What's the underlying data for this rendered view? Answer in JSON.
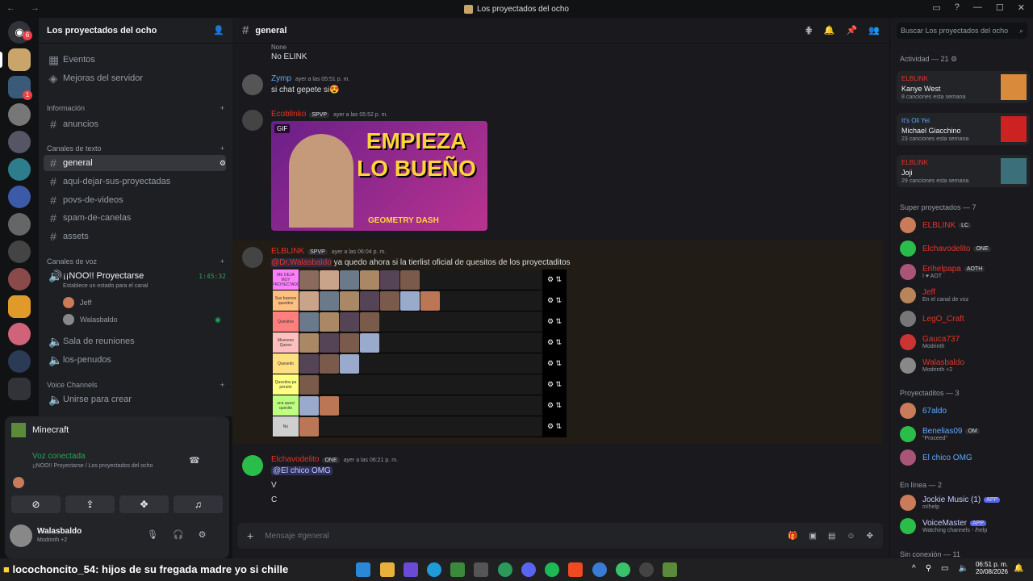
{
  "window": {
    "title": "Los proyectados del ocho"
  },
  "guild": {
    "name": "Los proyectados del ocho",
    "badge": "6"
  },
  "channels": {
    "top": [
      "Eventos",
      "Mejoras del servidor"
    ],
    "cat_info": "Información",
    "info": [
      "anuncios"
    ],
    "cat_text": "Canales de texto",
    "text": [
      "general",
      "aqui-dejar-sus-proyectadas",
      "povs-de-videos",
      "spam-de-canelas",
      "assets"
    ],
    "cat_voice": "Canales de voz",
    "voice_main": "¡¡NOO!! Proyectarse",
    "voice_status": "Establece un estado para el canal",
    "voice_timer": "1:45:32",
    "voice_users": [
      "Jeff",
      "Walasbaldo"
    ],
    "voice_other": [
      "Sala de reuniones",
      "los-penudos"
    ],
    "cat_voice2": "Voice Channels",
    "voice2": [
      "Unirse para crear"
    ]
  },
  "activity_card": {
    "game": "Minecraft",
    "status": "Voz conectada",
    "path": "¡¡NOO!! Proyectarse / Los proyectados del ocho"
  },
  "user": {
    "name": "Walasbaldo",
    "sub": "Modrinth +2"
  },
  "header": {
    "channel": "general",
    "search_placeholder": "Buscar Los proyectados del ocho"
  },
  "messages": [
    {
      "text_top": "None",
      "text": "No ELINK"
    },
    {
      "author": "Zymp",
      "time": "ayer a las 05:51 p. m.",
      "text": "si chat gepete si😍"
    },
    {
      "author": "Ecoblinko",
      "tag": "SPVP",
      "time": "ayer a las 05:52 p. m.",
      "gif_label": "GIF",
      "gif_text": "EMPIEZA LO BUEÑO",
      "gif_sub": "GEOMETRY DASH"
    },
    {
      "author": "ELBLINK",
      "tag": "SPVP",
      "time": "ayer a las 06:04 p. m.",
      "mention": "@Dr.Walasbaldo",
      "text": "ya quedo ahora si la tierlist oficial de quesitos de los proyectaditos"
    },
    {
      "author": "Elchavodelito",
      "tag": "ONE",
      "time": "ayer a las 06:21 p. m.",
      "mention": "@El chico OMG",
      "lines": [
        "V",
        "C"
      ]
    }
  ],
  "tierlist": {
    "labels": [
      "ME DEJA MUY PROYECTAD0",
      "Sus buenos quesitos",
      "Quesitos",
      "Mesoeso Queso",
      "Queseito",
      "Quesitos pa peruito",
      "una quesi quesito",
      "No"
    ],
    "colors": [
      "#ff7fff",
      "#ffbf7f",
      "#ff7f7f",
      "#ffbfbf",
      "#ffdf7f",
      "#ffff7f",
      "#bfff7f",
      "#cfcfcf"
    ],
    "counts": [
      6,
      7,
      4,
      4,
      3,
      1,
      2,
      1
    ]
  },
  "composer": {
    "placeholder": "Mensaje #general"
  },
  "members": {
    "activity_title": "Actividad — 21",
    "activity": [
      {
        "who": "ELBLINK",
        "track": "Kanye West",
        "sub": "8 canciones esta semana"
      },
      {
        "who": "It's Oli Yei",
        "track": "Michael Giacchino",
        "sub": "23 canciones esta semana"
      },
      {
        "who": "ELBLINK",
        "track": "Joji",
        "sub": "29 canciones esta semana"
      }
    ],
    "group1": "Super proyectados — 7",
    "g1": [
      {
        "n": "ELBLINK",
        "tag": "LC",
        "sub": ""
      },
      {
        "n": "Elchavodelito",
        "tag": "ONE",
        "sub": ""
      },
      {
        "n": "Erihelpapa",
        "tag": "AOTH",
        "sub": "I ♥ AOT"
      },
      {
        "n": "Jeff",
        "tag": "",
        "sub": "En el canal de voz"
      },
      {
        "n": "LegO_Craft",
        "tag": "",
        "sub": ""
      },
      {
        "n": "Gauca737",
        "tag": "",
        "sub": "Modrinth"
      },
      {
        "n": "Walasbaldo",
        "tag": "",
        "sub": "Modrinth +2"
      }
    ],
    "group2": "Proyectaditos — 3",
    "g2": [
      {
        "n": "67aldo",
        "tag": "",
        "sub": ""
      },
      {
        "n": "Benelias09",
        "tag": "OM",
        "sub": "\"Proceed\""
      },
      {
        "n": "El chico OMG",
        "tag": "",
        "sub": ""
      }
    ],
    "group3": "En línea — 2",
    "g3": [
      {
        "n": "Jockie Music (1)",
        "tag": "APP",
        "sub": "m!help"
      },
      {
        "n": "VoiceMaster",
        "tag": "APP",
        "sub": "Watching channels - /help"
      }
    ],
    "group4": "Sin conexión — 11"
  },
  "taskbar": {
    "ticker_user": "locochoncito_54",
    "ticker_text": ": hijos de su fregada madre yo si chille",
    "time": "06:51 p. m.",
    "date": "20/08/2026"
  }
}
